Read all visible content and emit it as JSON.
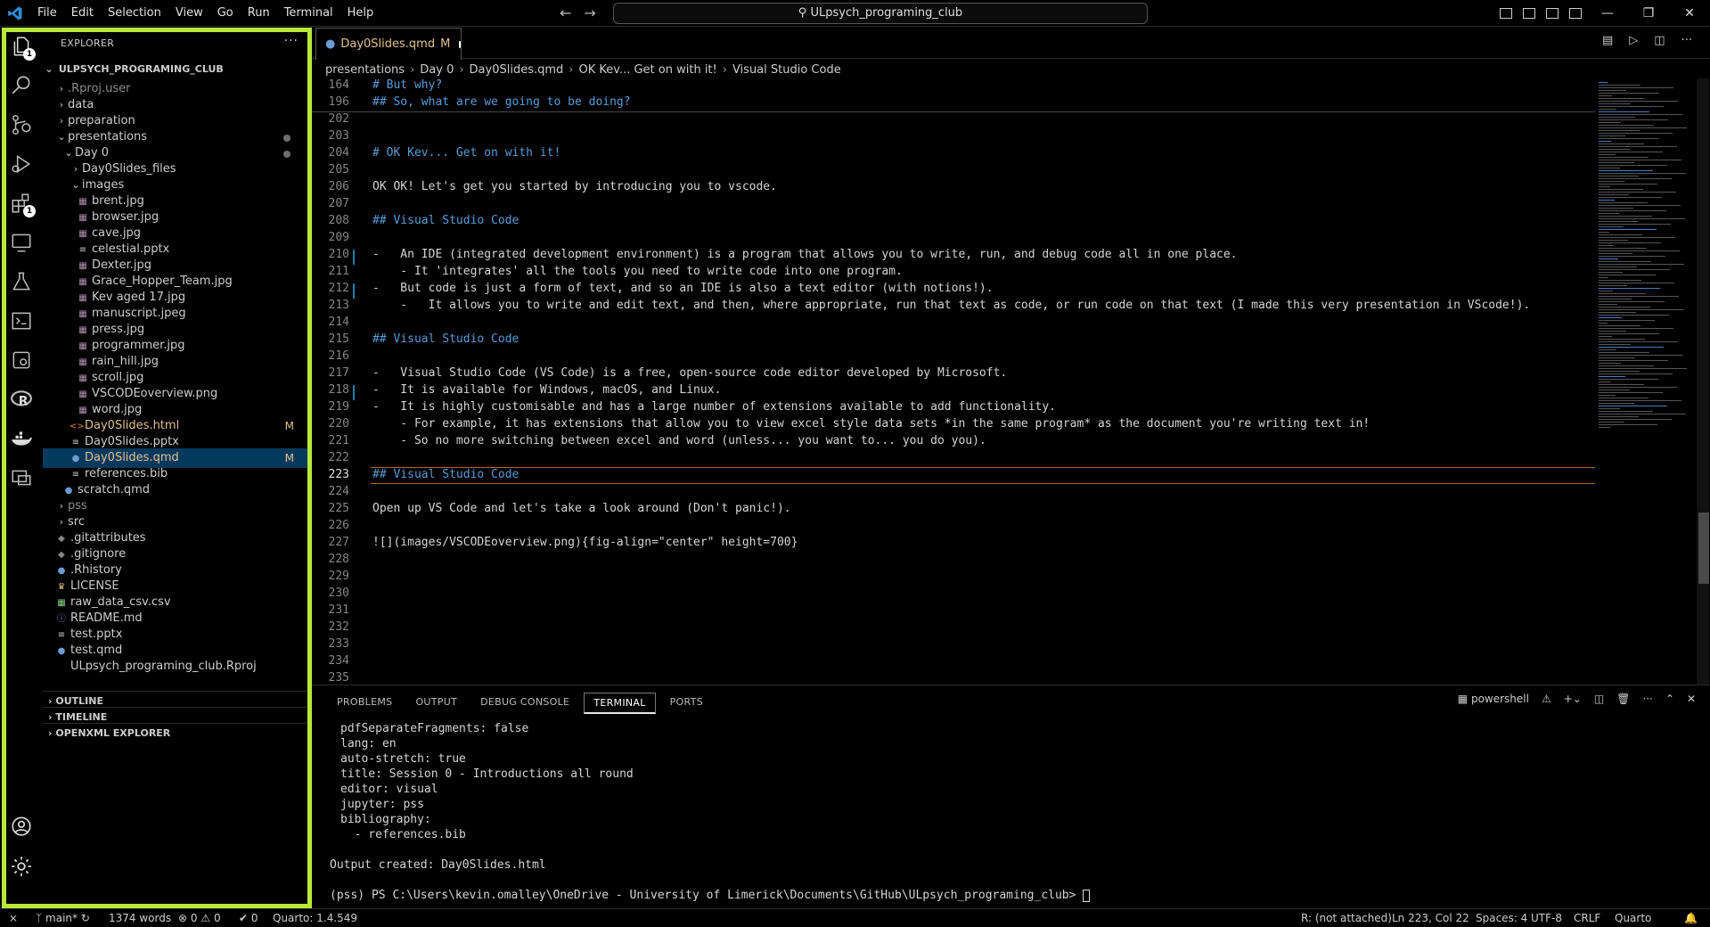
{
  "titlebar": {
    "menu": [
      "File",
      "Edit",
      "Selection",
      "View",
      "Go",
      "Run",
      "Terminal",
      "Help"
    ],
    "search_text": "ULpsych_programing_club"
  },
  "activitybar": {
    "explorer_badge": "1",
    "source_control_badge": "",
    "extensions_badge": "1"
  },
  "sidebar": {
    "header": "EXPLORER",
    "more": "···",
    "root": "ULPSYCH_PROGRAMING_CLUB",
    "items": [
      {
        "label": ".Rproj.user",
        "kind": "folder",
        "open": false,
        "dim": true
      },
      {
        "label": "data",
        "kind": "folder",
        "open": false
      },
      {
        "label": "preparation",
        "kind": "folder",
        "open": false
      },
      {
        "label": "presentations",
        "kind": "folder",
        "open": true,
        "modified": true
      },
      {
        "label": "Day 0",
        "kind": "folder",
        "open": true,
        "modified": true
      },
      {
        "label": "Day0Slides_files",
        "kind": "folder",
        "open": false
      },
      {
        "label": "images",
        "kind": "folder",
        "open": true
      },
      {
        "label": "brent.jpg",
        "kind": "image"
      },
      {
        "label": "browser.jpg",
        "kind": "image"
      },
      {
        "label": "cave.jpg",
        "kind": "image"
      },
      {
        "label": "celestial.pptx",
        "kind": "doc"
      },
      {
        "label": "Dexter.jpg",
        "kind": "image"
      },
      {
        "label": "Grace_Hopper_Team.jpg",
        "kind": "image"
      },
      {
        "label": "Kev aged 17.jpg",
        "kind": "image"
      },
      {
        "label": "manuscript.jpeg",
        "kind": "image"
      },
      {
        "label": "press.jpg",
        "kind": "image"
      },
      {
        "label": "programmer.jpg",
        "kind": "image"
      },
      {
        "label": "rain_hill.jpg",
        "kind": "image"
      },
      {
        "label": "scroll.jpg",
        "kind": "image"
      },
      {
        "label": "VSCODEoverview.png",
        "kind": "image"
      },
      {
        "label": "word.jpg",
        "kind": "image"
      },
      {
        "label": "Day0Slides.html",
        "kind": "html",
        "decoration": "M"
      },
      {
        "label": "Day0Slides.pptx",
        "kind": "doc"
      },
      {
        "label": "Day0Slides.qmd",
        "kind": "qmd",
        "decoration": "M",
        "selected": true
      },
      {
        "label": "references.bib",
        "kind": "doc"
      },
      {
        "label": "scratch.qmd",
        "kind": "qmd"
      },
      {
        "label": "pss",
        "kind": "folder",
        "open": false,
        "dim": true
      },
      {
        "label": "src",
        "kind": "folder",
        "open": false
      },
      {
        "label": ".gitattributes",
        "kind": "git"
      },
      {
        "label": ".gitignore",
        "kind": "git"
      },
      {
        "label": ".Rhistory",
        "kind": "r"
      },
      {
        "label": "LICENSE",
        "kind": "license"
      },
      {
        "label": "raw_data_csv.csv",
        "kind": "csv"
      },
      {
        "label": "README.md",
        "kind": "info"
      },
      {
        "label": "test.pptx",
        "kind": "doc"
      },
      {
        "label": "test.qmd",
        "kind": "qmd"
      },
      {
        "label": "ULpsych_programing_club.Rproj",
        "kind": "rproj"
      }
    ],
    "sections": [
      "OUTLINE",
      "TIMELINE",
      "OPENXML EXPLORER"
    ]
  },
  "editor": {
    "tab_label": "Day0Slides.qmd",
    "tab_status": "M",
    "breadcrumb": [
      "presentations",
      "Day 0",
      "Day0Slides.qmd",
      "OK Kev... Get on with it!",
      "Visual Studio Code"
    ],
    "lines": [
      {
        "n": "164",
        "text": "# But why?",
        "hdr": true
      },
      {
        "n": "196",
        "text": "## So, what are we going to be doing?",
        "hdr": true
      },
      {
        "n": "202",
        "text": ""
      },
      {
        "n": "203",
        "text": ""
      },
      {
        "n": "204",
        "text": "# OK Kev... Get on with it!",
        "hdr": true
      },
      {
        "n": "205",
        "text": ""
      },
      {
        "n": "206",
        "text": "OK OK! Let's get you started by introducing you to vscode."
      },
      {
        "n": "207",
        "text": ""
      },
      {
        "n": "208",
        "text": "## Visual Studio Code",
        "hdr": true
      },
      {
        "n": "209",
        "text": ""
      },
      {
        "n": "210",
        "text": "-   An IDE (integrated development environment) is a program that allows you to write, run, and debug code all in one place."
      },
      {
        "n": "211",
        "text": "    - It 'integrates' all the tools you need to write code into one program."
      },
      {
        "n": "212",
        "text": "-   But code is just a form of text, and so an IDE is also a text editor (with notions!)."
      },
      {
        "n": "213",
        "text": "    -   It allows you to write and edit text, and then, where appropriate, run that text as code, or run code on that text (I made this very presentation in VScode!)."
      },
      {
        "n": "214",
        "text": ""
      },
      {
        "n": "215",
        "text": "## Visual Studio Code",
        "hdr": true
      },
      {
        "n": "216",
        "text": ""
      },
      {
        "n": "217",
        "text": "-   Visual Studio Code (VS Code) is a free, open-source code editor developed by Microsoft."
      },
      {
        "n": "218",
        "text": "-   It is available for Windows, macOS, and Linux."
      },
      {
        "n": "219",
        "text": "-   It is highly customisable and has a large number of extensions available to add functionality."
      },
      {
        "n": "220",
        "text": "    - For example, it has extensions that allow you to view excel style data sets *in the same program* as the document you're writing text in!"
      },
      {
        "n": "221",
        "text": "    - So no more switching between excel and word (unless... you want to... you do you)."
      },
      {
        "n": "222",
        "text": ""
      },
      {
        "n": "223",
        "text": "## Visual Studio Code",
        "hdr": true,
        "current": true
      },
      {
        "n": "224",
        "text": ""
      },
      {
        "n": "225",
        "text": "Open up VS Code and let's take a look around (Don't panic!)."
      },
      {
        "n": "226",
        "text": ""
      },
      {
        "n": "227",
        "text": "![](images/VSCODEoverview.png){fig-align=\"center\" height=700}"
      },
      {
        "n": "228",
        "text": ""
      },
      {
        "n": "229",
        "text": ""
      },
      {
        "n": "230",
        "text": ""
      },
      {
        "n": "231",
        "text": ""
      },
      {
        "n": "232",
        "text": ""
      },
      {
        "n": "233",
        "text": ""
      },
      {
        "n": "234",
        "text": ""
      },
      {
        "n": "235",
        "text": ""
      }
    ]
  },
  "panel": {
    "tabs": [
      "PROBLEMS",
      "OUTPUT",
      "DEBUG CONSOLE",
      "TERMINAL",
      "PORTS"
    ],
    "active_tab": "TERMINAL",
    "shell_label": "powershell",
    "terminal_lines": [
      "pdfSeparateFragments: false",
      "lang: en",
      "auto-stretch: true",
      "title: Session 0 - Introductions all round",
      "editor: visual",
      "jupyter: pss",
      "bibliography:",
      "  - references.bib",
      "",
      "Output created: Day0Slides.html",
      "",
      "(pss) PS C:\\Users\\kevin.omalley\\OneDrive - University of Limerick\\Documents\\GitHub\\ULpsych_programing_club> "
    ]
  },
  "statusbar": {
    "branch": "main*",
    "words": "1374 words",
    "errors": "0",
    "warnings": "0",
    "ports": "0",
    "quarto": "Quarto: 1.4.549",
    "r_status": "R: (not attached)",
    "position": "Ln 223, Col 22",
    "spaces": "Spaces: 4",
    "encoding": "UTF-8",
    "eol": "CRLF",
    "language": "Quarto"
  }
}
